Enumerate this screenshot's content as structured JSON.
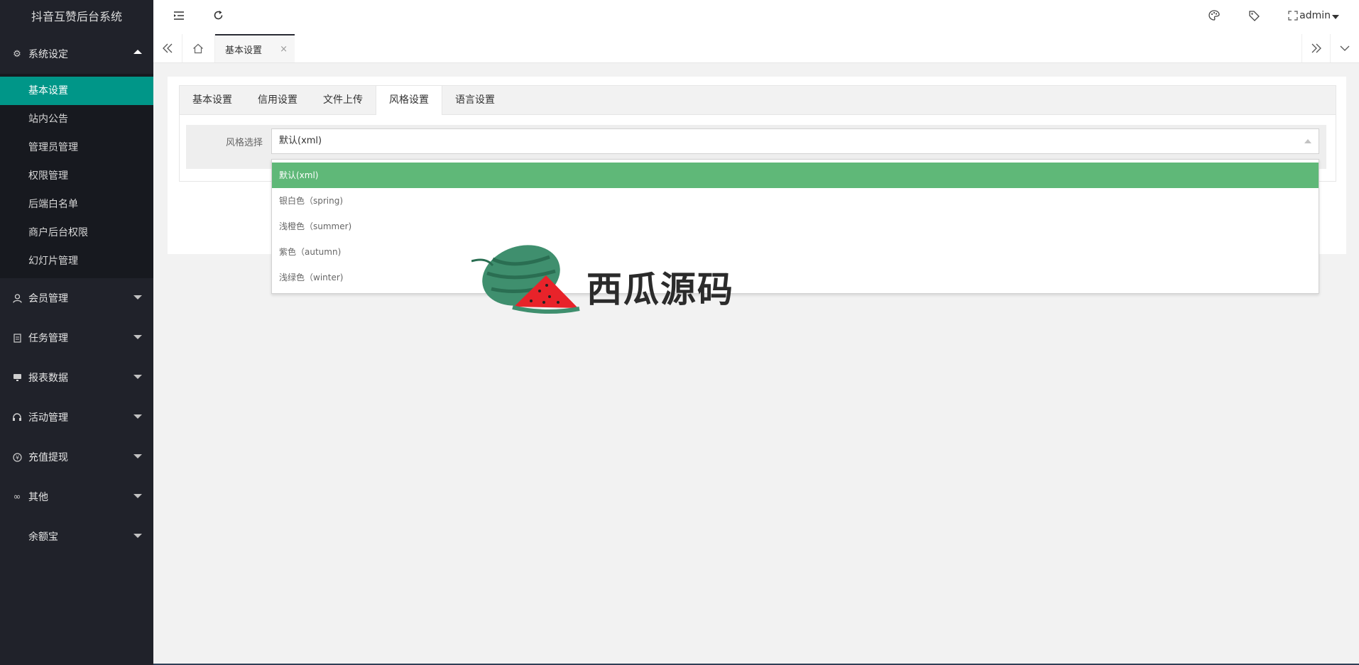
{
  "app": {
    "title": "抖音互赞后台系统"
  },
  "sidebar": {
    "groups": [
      {
        "label": "系统设定",
        "icon": "gear-icon",
        "expanded": true,
        "items": [
          "基本设置",
          "站内公告",
          "管理员管理",
          "权限管理",
          "后端白名单",
          "商户后台权限",
          "幻灯片管理"
        ],
        "active_item": "基本设置"
      },
      {
        "label": "会员管理",
        "icon": "user-icon"
      },
      {
        "label": "任务管理",
        "icon": "document-icon"
      },
      {
        "label": "报表数据",
        "icon": "monitor-icon"
      },
      {
        "label": "活动管理",
        "icon": "headset-icon"
      },
      {
        "label": "充值提现",
        "icon": "yen-icon"
      },
      {
        "label": "其他",
        "icon": "infinity-icon"
      },
      {
        "label": "余额宝",
        "icon": ""
      }
    ]
  },
  "header": {
    "user": "admin"
  },
  "tabbar": {
    "current_tab": "基本设置",
    "close_symbol": "×"
  },
  "settings_tabs": [
    "基本设置",
    "信用设置",
    "文件上传",
    "风格设置",
    "语言设置"
  ],
  "active_settings_tab": "风格设置",
  "form": {
    "label": "风格选择",
    "selected_value": "默认(xml)",
    "options": [
      "默认(xml)",
      "银白色（spring)",
      "浅橙色（summer)",
      "紫色（autumn)",
      "浅绿色（winter)"
    ]
  },
  "watermark": {
    "text": "西瓜源码"
  },
  "colors": {
    "sidebar_bg": "#20222a",
    "active_teal": "#009688",
    "selected_green": "#5fb878"
  }
}
